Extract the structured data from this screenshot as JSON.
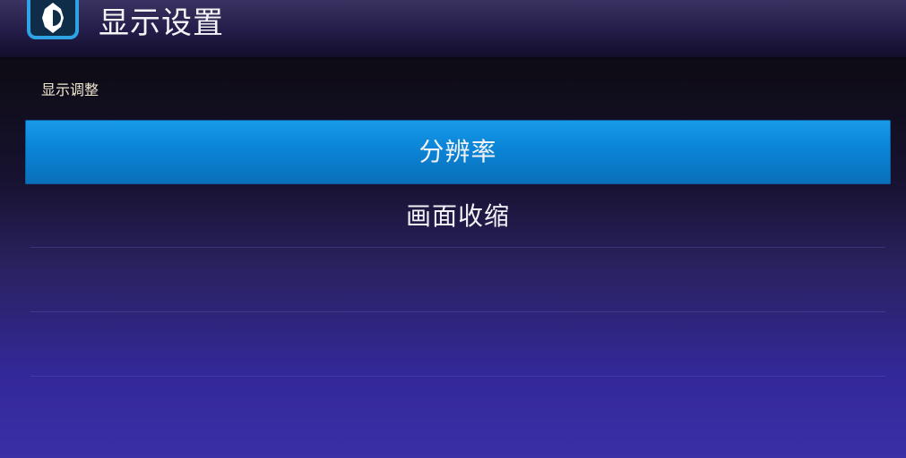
{
  "header": {
    "title": "显示设置",
    "icon": "display-settings-icon"
  },
  "section": {
    "label": "显示调整"
  },
  "menu": {
    "items": [
      {
        "label": "分辨率",
        "selected": true
      },
      {
        "label": "画面收缩",
        "selected": false
      }
    ]
  },
  "colors": {
    "accent": "#0b86d8",
    "icon_border": "#2ea4e6",
    "section_label": "#f1e8d0"
  }
}
